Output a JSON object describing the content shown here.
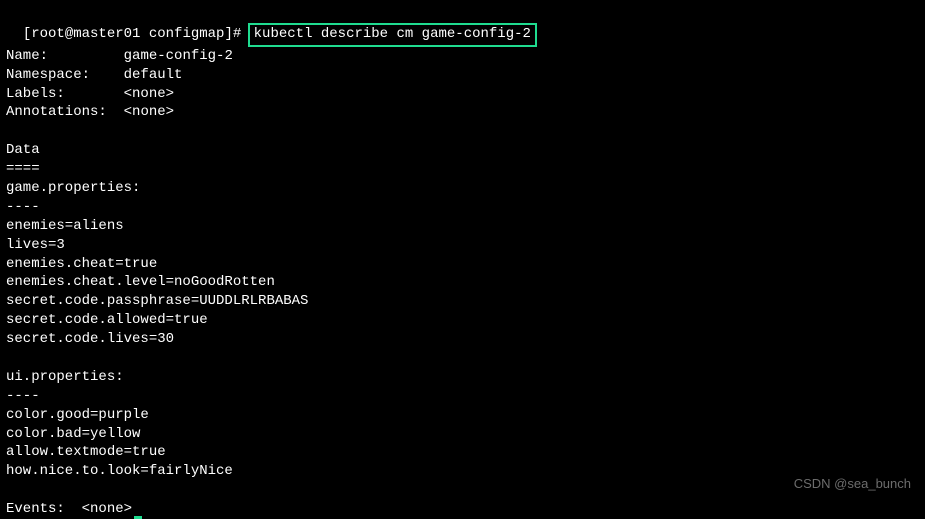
{
  "prompt": {
    "prefix": "[root@master01 configmap]# ",
    "command": "kubectl describe cm game-config-2"
  },
  "meta": {
    "name_label": "Name:",
    "name_value": "game-config-2",
    "namespace_label": "Namespace:",
    "namespace_value": "default",
    "labels_label": "Labels:",
    "labels_value": "<none>",
    "annotations_label": "Annotations:",
    "annotations_value": "<none>"
  },
  "data_header": "Data",
  "data_sep": "====",
  "sections": [
    {
      "title": "game.properties:",
      "sep": "----",
      "lines": [
        "enemies=aliens",
        "lives=3",
        "enemies.cheat=true",
        "enemies.cheat.level=noGoodRotten",
        "secret.code.passphrase=UUDDLRLRBABAS",
        "secret.code.allowed=true",
        "secret.code.lives=30"
      ]
    },
    {
      "title": "ui.properties:",
      "sep": "----",
      "lines": [
        "color.good=purple",
        "color.bad=yellow",
        "allow.textmode=true",
        "how.nice.to.look=fairlyNice"
      ]
    }
  ],
  "events": {
    "label": "Events:",
    "value": "<none>"
  },
  "watermark": "CSDN @sea_bunch"
}
